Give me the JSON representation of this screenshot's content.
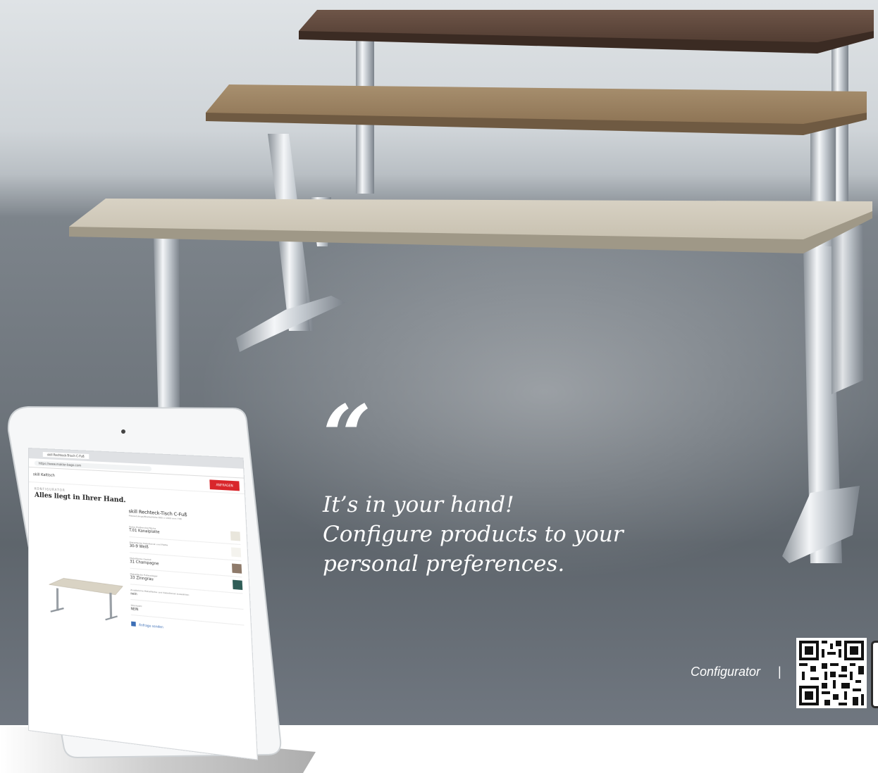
{
  "quote": {
    "mark": "“",
    "lines": [
      "It’s in your hand!",
      "Configure products to your",
      "personal preferences."
    ]
  },
  "configurator": {
    "label": "Configurator",
    "separator": "|"
  },
  "tablet": {
    "browser_tab": "skill Rechteck-Trisch C-Fuß",
    "address": "https://www.makler-bago.com",
    "brand": "skill Kaltisch",
    "header_button": "ANFRAGEN",
    "heading_small": "KONFIGURATOR",
    "heading": "Alles liegt in Ihrer Hand.",
    "product_title": "skill Rechteck-Tisch C-Fuß",
    "product_sub": "Masse/Länge/Breite/Höhe 800 x 1400 mm 738",
    "options": [
      {
        "label": "Farbe Plattenoberfläche",
        "value": "T.01 Kanalplatte"
      },
      {
        "label": "Metallfarbe Kabelkanal und Platte",
        "value": "30-9 Weiß"
      },
      {
        "label": "Metallfarbe Gestell",
        "value": "31 Champagne"
      },
      {
        "label": "Metallfarbe Fußausleger",
        "value": "33 Zinngrau"
      }
    ],
    "extra_label": "Zusätzliche Metallfarbe und Kabelkanal auswählen",
    "extra_value": "nein",
    "qty_label": "Stückzahl",
    "qty_value": "NEIN",
    "cart_button": "Anfrage senden"
  },
  "colors": {
    "swatch_1": "#e9e6dc",
    "swatch_2": "#f4f3ee",
    "swatch_3": "#8e7a6a",
    "swatch_4": "#2f5d57",
    "accent": "#d9262b"
  }
}
